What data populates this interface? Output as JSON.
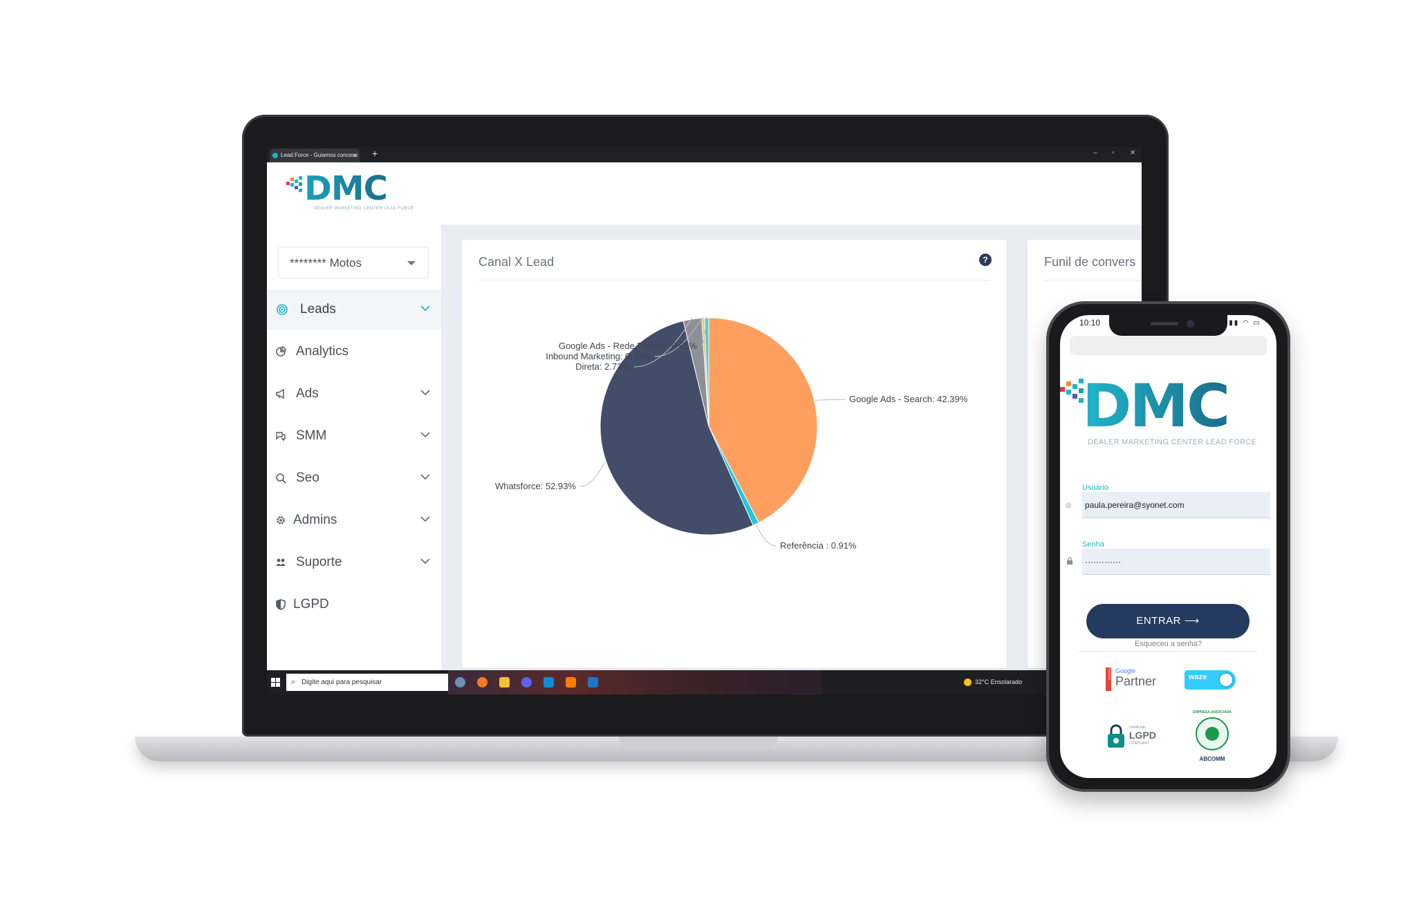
{
  "browser": {
    "tab_title": "Lead Force - Guiamos concess",
    "tab_close": "×",
    "new_tab": "+",
    "minimize": "–",
    "restore": "▫",
    "close": "✕"
  },
  "brand": {
    "logo": "DMC",
    "tagline": "DEALER MARKETING CENTER LEAD FORCE",
    "accent_color": "#1fb6c9",
    "navy_color": "#243a5e"
  },
  "sidebar": {
    "store_select": "******** Motos",
    "items": [
      {
        "label": "Leads",
        "icon": "target-icon",
        "expandable": true,
        "active": true
      },
      {
        "label": "Analytics",
        "icon": "pie-chart-icon",
        "expandable": false,
        "active": false
      },
      {
        "label": "Ads",
        "icon": "megaphone-icon",
        "expandable": true,
        "active": false
      },
      {
        "label": "SMM",
        "icon": "chat-icon",
        "expandable": true,
        "active": false
      },
      {
        "label": "Seo",
        "icon": "search-icon",
        "expandable": true,
        "active": false
      },
      {
        "label": "Admins",
        "icon": "gear-icon",
        "expandable": true,
        "active": false
      },
      {
        "label": "Suporte",
        "icon": "users-icon",
        "expandable": true,
        "active": false
      },
      {
        "label": "LGPD",
        "icon": "shield-icon",
        "expandable": false,
        "active": false
      }
    ]
  },
  "cards": {
    "canal": {
      "title": "Canal X Lead",
      "help": "?"
    },
    "funil": {
      "title": "Funil de convers"
    }
  },
  "chart_data": {
    "type": "pie",
    "title": "",
    "slices": [
      {
        "label": "Google Ads - Search: 42.39%",
        "name": "Google Ads - Search",
        "value": 42.39,
        "color": "#ff9f5f"
      },
      {
        "label": "Referência : 0.91%",
        "name": "Referência",
        "value": 0.91,
        "color": "#1fc8dc"
      },
      {
        "label": "Whatsforce: 52.93%",
        "name": "Whatsforce",
        "value": 52.93,
        "color": "#434d6a"
      },
      {
        "label": "Direta: 2.73%",
        "name": "Direta",
        "value": 2.73,
        "color": "#8f9096"
      },
      {
        "label": "Inbound Marketing: 0.39%",
        "name": "Inbound Marketing",
        "value": 0.39,
        "color": "#e6c36a"
      },
      {
        "label": "Google Ads - Rede Display: 0.65%",
        "name": "Google Ads - Rede Display",
        "value": 0.65,
        "color": "#5ec7d6"
      }
    ]
  },
  "taskbar": {
    "search_placeholder": "Digite aqui para pesquisar",
    "weather": "32°C  Ensolarado"
  },
  "phone": {
    "time": "10:10",
    "status_icons": "▮▮▮ ◠ ▭",
    "logo": "DMC",
    "tagline": "DEALER MARKETING CENTER LEAD FORCE",
    "user_label": "Usuário",
    "user_value": "paula.pereira@syonet.com",
    "password_label": "Senha",
    "password_value": "·············",
    "login_button": "ENTRAR",
    "login_arrow": "⟶",
    "forgot": "Esqueceu a senha?",
    "badges": {
      "google_partner": {
        "small": "Google",
        "big": "Partner",
        "side": "PREMIER"
      },
      "waze": {
        "text": "waze"
      },
      "lgpd": {
        "small": "Certificado",
        "big": "LGPD",
        "sub": "COMPLIANT"
      },
      "abcomm": {
        "ring": "EMPRESA ASSOCIADA",
        "name": "ABCOMM"
      }
    }
  }
}
